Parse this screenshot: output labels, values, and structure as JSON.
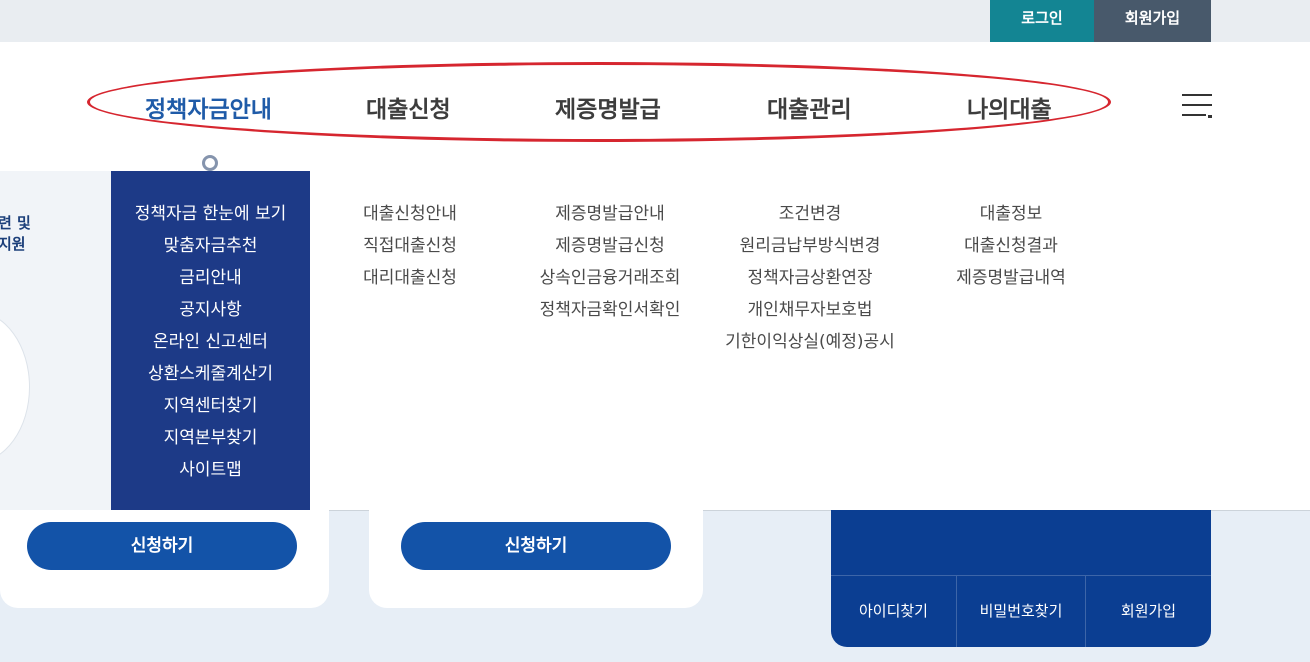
{
  "topbar": {
    "login": "로그인",
    "signup": "회원가입"
  },
  "gnb": {
    "items": [
      "정책자금안내",
      "대출신청",
      "제증명발급",
      "대출관리",
      "나의대출"
    ],
    "active_index": 0
  },
  "mega": {
    "left_peek_text": "련 및\n지원",
    "columns": [
      [
        "정책자금 한눈에 보기",
        "맞춤자금추천",
        "금리안내",
        "공지사항",
        "온라인 신고센터",
        "상환스케줄계산기",
        "지역센터찾기",
        "지역본부찾기",
        "사이트맵"
      ],
      [
        "대출신청안내",
        "직접대출신청",
        "대리대출신청"
      ],
      [
        "제증명발급안내",
        "제증명발급신청",
        "상속인금융거래조회",
        "정책자금확인서확인"
      ],
      [
        "조건변경",
        "원리금납부방식변경",
        "정책자금상환연장",
        "개인채무자보호법",
        "기한이익상실(예정)공시"
      ],
      [
        "대출정보",
        "대출신청결과",
        "제증명발급내역"
      ]
    ]
  },
  "cards": {
    "apply_label": "신청하기"
  },
  "login_panel": {
    "links": [
      "아이디찾기",
      "비밀번호찾기",
      "회원가입"
    ]
  },
  "colors": {
    "accent": "#1f5ba8",
    "active_column": "#1d3a87",
    "highlight_ring": "#d6262f",
    "login_teal": "#138593"
  }
}
